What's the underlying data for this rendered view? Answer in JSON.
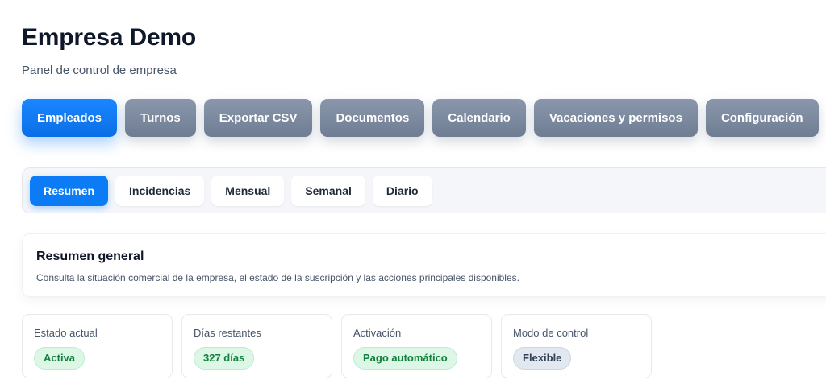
{
  "header": {
    "title": "Empresa Demo",
    "subtitle": "Panel de control de empresa"
  },
  "main_tabs": [
    {
      "label": "Empleados",
      "active": true
    },
    {
      "label": "Turnos",
      "active": false
    },
    {
      "label": "Exportar CSV",
      "active": false
    },
    {
      "label": "Documentos",
      "active": false
    },
    {
      "label": "Calendario",
      "active": false
    },
    {
      "label": "Vacaciones y permisos",
      "active": false
    },
    {
      "label": "Configuración",
      "active": false
    }
  ],
  "sub_tabs": [
    {
      "label": "Resumen",
      "active": true
    },
    {
      "label": "Incidencias",
      "active": false
    },
    {
      "label": "Mensual",
      "active": false
    },
    {
      "label": "Semanal",
      "active": false
    },
    {
      "label": "Diario",
      "active": false
    }
  ],
  "summary": {
    "title": "Resumen general",
    "description": "Consulta la situación comercial de la empresa, el estado de la suscripción y las acciones principales disponibles."
  },
  "stats": [
    {
      "label": "Estado actual",
      "value": "Activa",
      "tone": "green"
    },
    {
      "label": "Días restantes",
      "value": "327 días",
      "tone": "green"
    },
    {
      "label": "Activación",
      "value": "Pago automático",
      "tone": "green"
    },
    {
      "label": "Modo de control",
      "value": "Flexible",
      "tone": "gray"
    }
  ],
  "colors": {
    "accent": "#0b7cf5",
    "tab_inactive": "#7b889d",
    "badge_green_bg": "#dcf7e6",
    "badge_green_text": "#15803d",
    "badge_gray_bg": "#e2e8f0"
  }
}
